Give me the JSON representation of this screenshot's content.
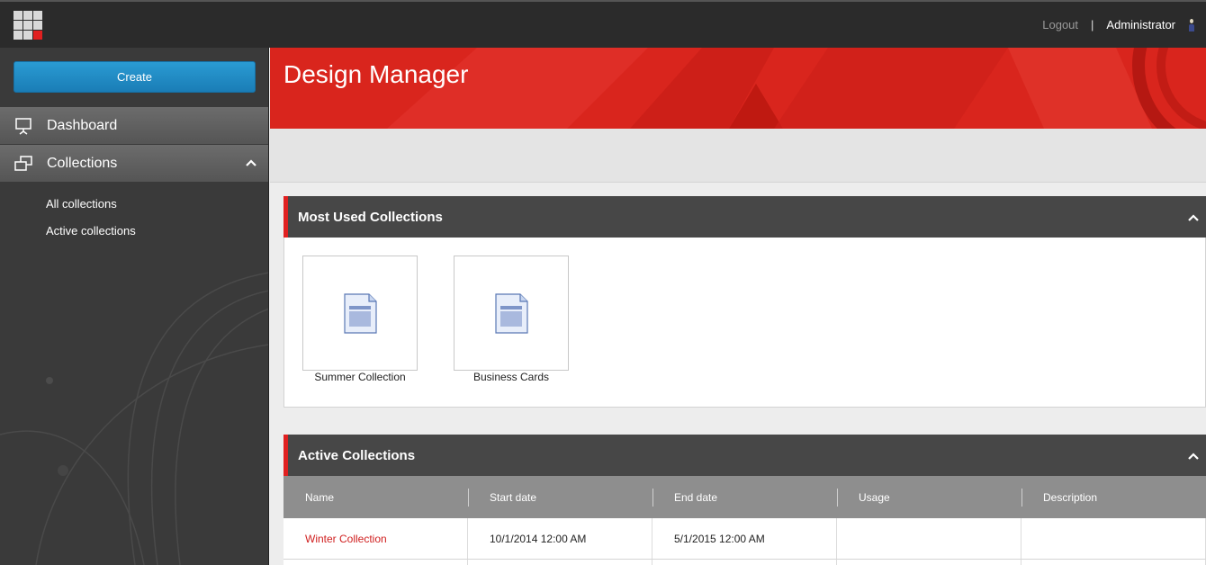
{
  "topbar": {
    "logout": "Logout",
    "separator": "|",
    "user": "Administrator"
  },
  "sidebar": {
    "create_label": "Create",
    "items": [
      {
        "label": "Dashboard"
      },
      {
        "label": "Collections"
      }
    ],
    "subitems": [
      {
        "label": "All collections"
      },
      {
        "label": "Active collections"
      }
    ]
  },
  "header": {
    "title": "Design Manager"
  },
  "most_used": {
    "title": "Most Used Collections",
    "tiles": [
      {
        "label": "Summer Collection"
      },
      {
        "label": "Business Cards"
      }
    ]
  },
  "active": {
    "title": "Active Collections",
    "columns": [
      "Name",
      "Start date",
      "End date",
      "Usage",
      "Description"
    ],
    "rows": [
      {
        "name": "Winter Collection",
        "start": "10/1/2014 12:00 AM",
        "end": "5/1/2015 12:00 AM",
        "usage": "",
        "description": ""
      }
    ]
  },
  "colors": {
    "accent": "#e02020",
    "create": "#1f8cc6",
    "topbar": "#2b2b2b"
  }
}
